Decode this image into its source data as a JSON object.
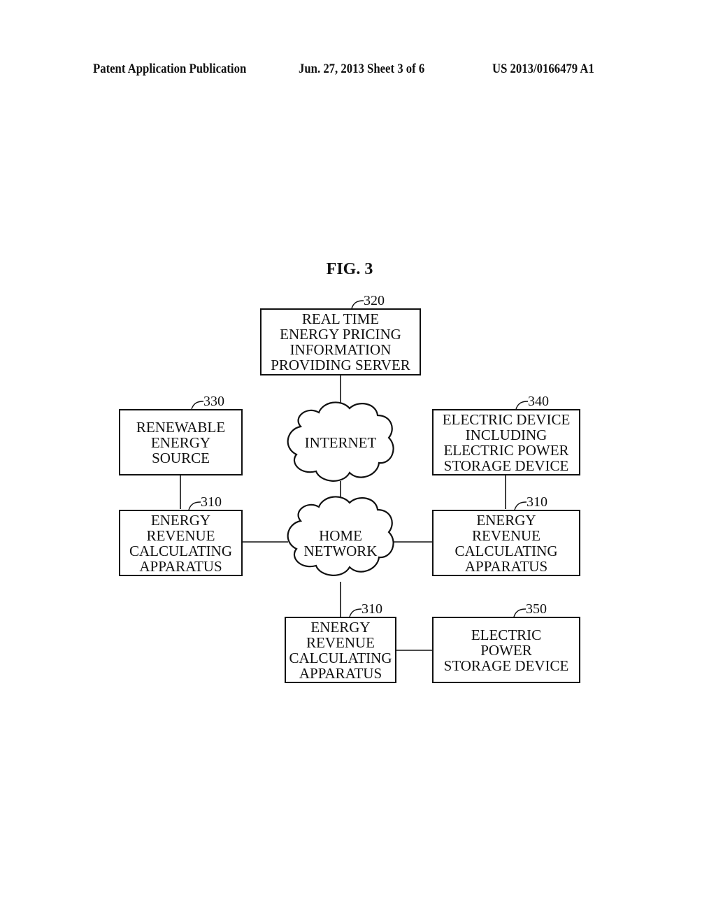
{
  "header": {
    "left": "Patent Application Publication",
    "center": "Jun. 27, 2013  Sheet 3 of 6",
    "right": "US 2013/0166479 A1"
  },
  "figure": {
    "title": "FIG. 3",
    "nodes": {
      "server": {
        "ref": "320",
        "label": "REAL TIME\nENERGY PRICING\nINFORMATION\nPROVIDING SERVER"
      },
      "renewable": {
        "ref": "330",
        "label": "RENEWABLE\nENERGY\nSOURCE"
      },
      "electric_device": {
        "ref": "340",
        "label": "ELECTRIC DEVICE\nINCLUDING\nELECTRIC POWER\nSTORAGE DEVICE"
      },
      "apparatus_left": {
        "ref": "310",
        "label": "ENERGY\nREVENUE\nCALCULATING\nAPPARATUS"
      },
      "apparatus_right": {
        "ref": "310",
        "label": "ENERGY\nREVENUE\nCALCULATING\nAPPARATUS"
      },
      "apparatus_bottom": {
        "ref": "310",
        "label": "ENERGY\nREVENUE\nCALCULATING\nAPPARATUS"
      },
      "storage": {
        "ref": "350",
        "label": "ELECTRIC\nPOWER\nSTORAGE DEVICE"
      },
      "internet": {
        "label": "INTERNET"
      },
      "home_network": {
        "label": "HOME\nNETWORK"
      }
    },
    "connections": [
      [
        "server",
        "internet"
      ],
      [
        "internet",
        "home_network"
      ],
      [
        "renewable",
        "apparatus_left"
      ],
      [
        "electric_device",
        "apparatus_right"
      ],
      [
        "apparatus_left",
        "home_network"
      ],
      [
        "home_network",
        "apparatus_right"
      ],
      [
        "home_network",
        "apparatus_bottom"
      ],
      [
        "apparatus_bottom",
        "storage"
      ]
    ]
  }
}
